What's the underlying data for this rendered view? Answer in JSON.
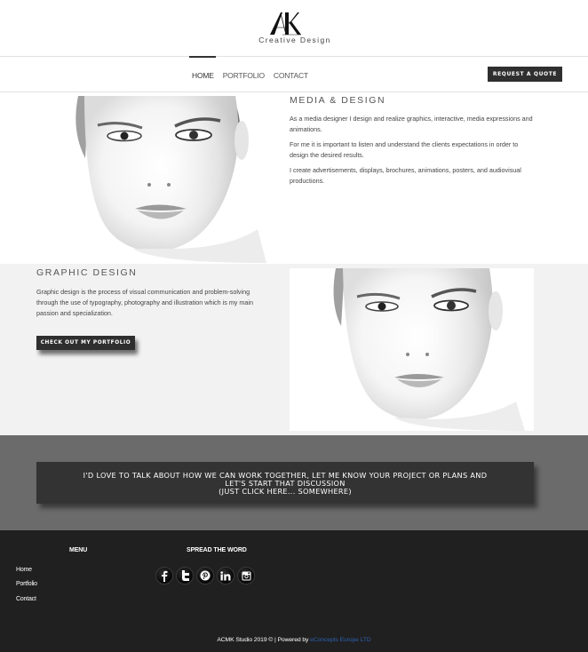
{
  "header": {
    "logo_monogram": "AK",
    "logo_text": "Creative Design"
  },
  "nav": {
    "items": [
      {
        "label": "HOME",
        "active": true
      },
      {
        "label": "PORTFOLIO",
        "active": false
      },
      {
        "label": "CONTACT",
        "active": false
      }
    ],
    "cta_label": "REQUEST A QUOTE"
  },
  "media_design": {
    "title": "MEDIA & DESIGN",
    "paragraphs": [
      "As a media designer I design and realize graphics, interactive, media expressions and animations.",
      "For me it is important to listen and understand the clients expectations in order to design the desired results.",
      "I create advertisements, displays, brochures, animations, posters,  and audiovisual productions."
    ],
    "image_alt": "Black and white portrait of a woman"
  },
  "graphic_design": {
    "title": "GRAPHIC DESIGN",
    "paragraph": "Graphic design is the process of visual communication and problem-solving through the use of typography, photography and illustration which is my main passion and specialization.",
    "button_label": "CHECK OUT MY PORTFOLIO",
    "image_alt": "Black and white portrait of a woman"
  },
  "cta": {
    "lines": [
      "I'D LOVE TO TALK ABOUT HOW WE CAN WORK TOGETHER, LET ME KNOW YOUR PROJECT OR PLANS AND",
      "LET'S START THAT DISCUSSION",
      "(JUST CLICK HERE... SOMEWHERE)"
    ]
  },
  "footer": {
    "menu_heading": "MENU",
    "menu_links": [
      "Home",
      "Portfolio",
      "Contact"
    ],
    "spread_heading": "SPREAD THE WORD",
    "social": [
      {
        "name": "facebook",
        "glyph": "f"
      },
      {
        "name": "twitter",
        "glyph": "t"
      },
      {
        "name": "pinterest",
        "glyph": "p"
      },
      {
        "name": "linkedin",
        "glyph": "in"
      },
      {
        "name": "instagram",
        "glyph": ""
      }
    ],
    "copyright_text": "ACMK Studio 2019 © | Powered by ",
    "copyright_link": "eConcepts Europe LTD",
    "link_color": "#2a5fb0"
  },
  "colors": {
    "dark_button": "#2f2f2f",
    "section_gray": "#f2f2f2",
    "cta_band": "#6b6b6b",
    "cta_box": "#333333",
    "footer_bg": "#202020"
  }
}
